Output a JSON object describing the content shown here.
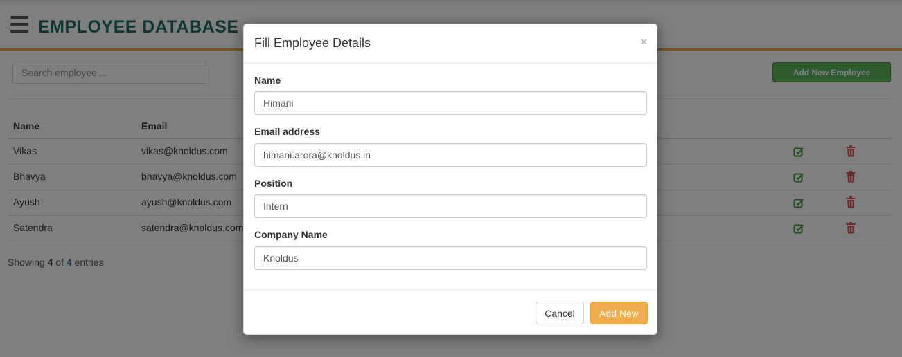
{
  "app": {
    "title": "EMPLOYEE DATABASE"
  },
  "toolbar": {
    "search_placeholder": "Search employee ...",
    "add_button_label": "Add New Employee"
  },
  "table": {
    "headers": {
      "name": "Name",
      "email": "Email"
    },
    "rows": [
      {
        "name": "Vikas",
        "email": "vikas@knoldus.com"
      },
      {
        "name": "Bhavya",
        "email": "bhavya@knoldus.com"
      },
      {
        "name": "Ayush",
        "email": "ayush@knoldus.com"
      },
      {
        "name": "Satendra",
        "email": "satendra@knoldus.com"
      }
    ],
    "icons": {
      "edit": "edit-icon",
      "delete": "trash-icon"
    }
  },
  "pagination": {
    "prefix": "Showing ",
    "shown": "4",
    "middle": " of ",
    "total": "4",
    "suffix": " entries"
  },
  "modal": {
    "title": "Fill Employee Details",
    "close_symbol": "×",
    "fields": [
      {
        "label": "Name",
        "value": "Himani"
      },
      {
        "label": "Email address",
        "value": "himani.arora@knoldus.in"
      },
      {
        "label": "Position",
        "value": "Intern"
      },
      {
        "label": "Company Name",
        "value": "Knoldus"
      }
    ],
    "cancel_label": "Cancel",
    "submit_label": "Add New"
  },
  "colors": {
    "brand": "#1e6e6a",
    "header_rule": "#e8a33c",
    "add_employee_button": "#5cb85c",
    "edit_icon": "#3c9a3c",
    "delete_icon": "#d9534f",
    "submit_button": "#f0ad4e"
  }
}
